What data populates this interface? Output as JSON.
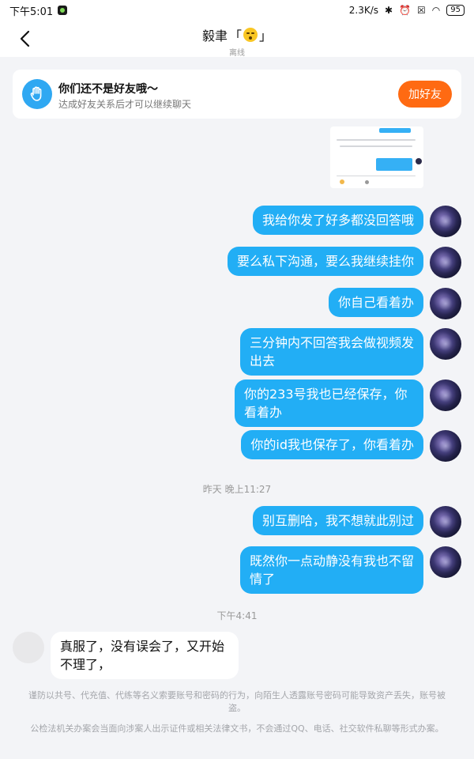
{
  "status_bar": {
    "time": "下午5:01",
    "net_speed": "2.3K/s",
    "battery": "95"
  },
  "header": {
    "title_name": "毅聿",
    "title_open": "「",
    "title_close": "」",
    "subtitle": "离线"
  },
  "banner": {
    "title": "你们还不是好友哦～",
    "subtitle": "达成好友关系后才可以继续聊天",
    "add_button": "加好友",
    "accent": "#ff6a12"
  },
  "messages": [
    {
      "side": "out",
      "text": "我给你发了好多都没回答哦"
    },
    {
      "side": "out",
      "text": "要么私下沟通，要么我继续挂你"
    },
    {
      "side": "out",
      "text": "你自己看着办"
    },
    {
      "side": "out",
      "text": "三分钟内不回答我会做视频发出去"
    },
    {
      "side": "out",
      "text": "你的233号我也已经保存，你看着办"
    },
    {
      "side": "out",
      "text": "你的id我也保存了，你看着办"
    },
    {
      "type": "time",
      "text": "昨天 晚上11:27"
    },
    {
      "side": "out",
      "text": "别互删哈，我不想就此别过"
    },
    {
      "side": "out",
      "text": "既然你一点动静没有我也不留情了"
    },
    {
      "type": "time",
      "text": "下午4:41"
    },
    {
      "side": "in",
      "text": "真服了，没有误会了，又开始不理了，"
    }
  ],
  "footer_notes": [
    "谨防以共号、代充值、代练等名义索要账号和密码的行为，向陌生人透露账号密码可能导致资产丢失，账号被盗。",
    "公检法机关办案会当面向涉案人出示证件或相关法律文书，不会通过QQ、电话、社交软件私聊等形式办案。"
  ],
  "colors": {
    "bubble_out": "#22aef5",
    "background": "#f3f4f7"
  }
}
